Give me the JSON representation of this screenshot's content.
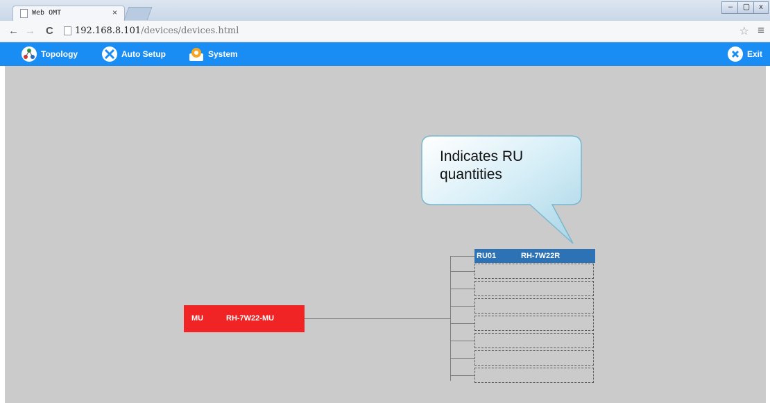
{
  "browser": {
    "tab_title": "Web OMT",
    "tab_close": "×",
    "url_host": "192.168.8.101",
    "url_path": "/devices/devices.html",
    "controls": {
      "minimize": "–",
      "restore": "▢",
      "close": "x"
    },
    "nav": {
      "back": "←",
      "forward": "→",
      "reload": "C"
    }
  },
  "menubar": {
    "color": "#1a8df5",
    "items": [
      {
        "label": "Topology",
        "icon": "topology-icon"
      },
      {
        "label": "Auto Setup",
        "icon": "tools-icon"
      },
      {
        "label": "System",
        "icon": "system-gear-icon"
      }
    ],
    "exit_label": "Exit"
  },
  "topology": {
    "mu": {
      "name": "MU",
      "model": "RH-7W22-MU",
      "color": "#f02424"
    },
    "ru": {
      "name": "RU01",
      "model": "RH-7W22R",
      "color": "#2d72b4"
    },
    "empty_slots": 7
  },
  "callout": {
    "text": "Indicates RU quantities"
  }
}
